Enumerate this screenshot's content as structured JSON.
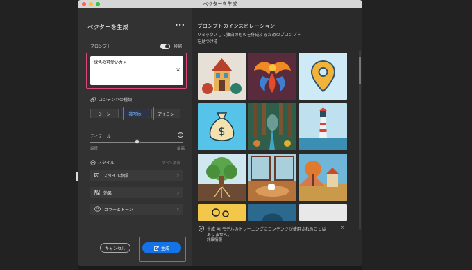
{
  "window": {
    "title": "ベクターを生成"
  },
  "left": {
    "panel_title": "ベクターを生成",
    "more_label": "•••",
    "prompt_label": "プロンプト",
    "suggest_label": "候補",
    "prompt_value": "緑色の可愛いカメ",
    "clear_label": "×",
    "content_type_label": "コンテンツの種類",
    "content_types": [
      "シーン",
      "被写体",
      "アイコン"
    ],
    "detail_label": "ディテール",
    "info_label": "i",
    "detail_min": "最低",
    "detail_max": "最高",
    "detail_level": 0.5,
    "style_label": "スタイル",
    "clear_all_label": "すべて消去",
    "rows": [
      {
        "label": "スタイル参照",
        "icon": "style-reference-icon"
      },
      {
        "label": "効果",
        "icon": "effects-icon"
      },
      {
        "label": "カラーとトーン",
        "icon": "color-tone-icon"
      }
    ],
    "chevron": "›",
    "cancel_label": "キャンセル",
    "generate_label": "生成"
  },
  "right": {
    "title": "プロンプトのインスピレーション",
    "subtitle_line1": "リミックスして独自のものを作成するためのプロンプト",
    "subtitle_line2": "を見つける",
    "notice_text_line1": "生成 AI モデルのトレーニングにコンテンツが使用されることは",
    "notice_text_line2": "ありません。",
    "notice_link": "詳細情報",
    "notice_close": "×"
  },
  "colors": {
    "accent": "#1473e6",
    "highlight": "#e0457b",
    "selected": "#5ba0ff"
  }
}
